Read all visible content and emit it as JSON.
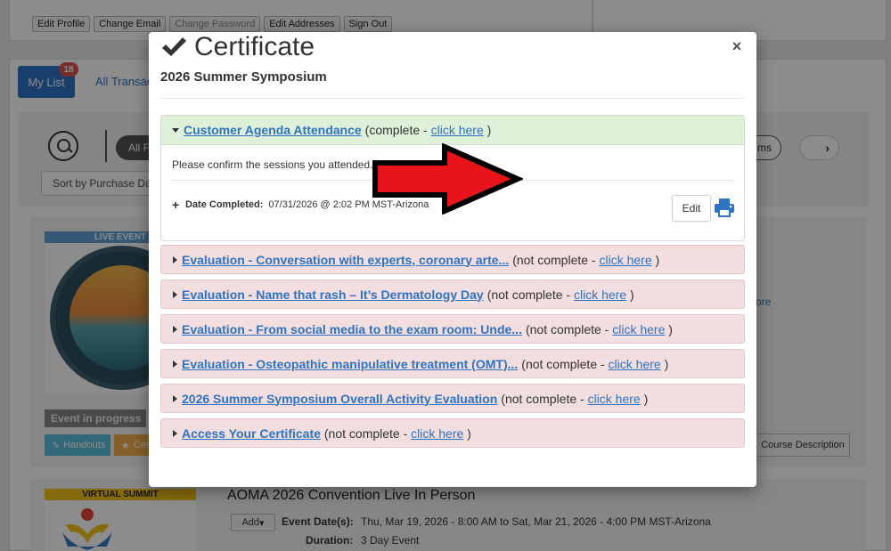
{
  "background": {
    "profile_buttons": [
      "Edit Profile",
      "Change Email",
      "Change Password",
      "Edit Addresses",
      "Sign Out"
    ],
    "tabs": {
      "my_list": "My List",
      "my_list_badge": "18",
      "all_transactions": "All Transac"
    },
    "filter": {
      "all_pill": "All F",
      "right_pill": "ms",
      "sort": "Sort by Purchase Da"
    },
    "event1": {
      "label": "LIVE EVENT",
      "progress": "Event in progress",
      "handouts": "Handouts",
      "cert": "Cer",
      "more": "ore",
      "course_description": "Course Description"
    },
    "event2": {
      "label": "VIRTUAL SUMMIT",
      "title": "AOMA 2026 Convention Live In Person",
      "add": "Add",
      "dates_label": "Event Date(s):",
      "dates_value": "Thu, Mar 19, 2026 - 8:00 AM to Sat, Mar 21, 2026 - 4:00 PM MST-Arizona",
      "duration_label": "Duration:",
      "duration_value": "3 Day Event"
    }
  },
  "modal": {
    "title": "Certificate",
    "close": "×",
    "subtitle": "2026 Summer Symposium",
    "open_section": {
      "title": "Customer Agenda Attendance ",
      "status_prefix": "(complete - ",
      "link": "click here",
      "status_suffix": " )",
      "body_text": "Please confirm the sessions you attended.",
      "date_label": "Date Completed:",
      "date_value": "07/31/2026 @ 2:02 PM MST-Arizona",
      "edit": "Edit"
    },
    "sections": [
      {
        "title": "Evaluation - Conversation with experts, coronary arte... ",
        "status": "(not complete - ",
        "link": "click here",
        "suffix": " )"
      },
      {
        "title": "Evaluation - Name that rash – It’s Dermatology Day ",
        "status": "(not complete - ",
        "link": "click here",
        "suffix": " )"
      },
      {
        "title": "Evaluation - From social media to the exam room: Unde... ",
        "status": "(not complete - ",
        "link": "click here",
        "suffix": " )"
      },
      {
        "title": "Evaluation - Osteopathic manipulative treatment (OMT)... ",
        "status": "(not complete - ",
        "link": "click here",
        "suffix": " )"
      },
      {
        "title": "2026 Summer Symposium Overall Activity Evaluation ",
        "status": "(not complete - ",
        "link": "click here",
        "suffix": " )"
      },
      {
        "title": "Access Your Certificate ",
        "status": "(not complete - ",
        "link": "click here",
        "suffix": " )"
      }
    ]
  },
  "colors": {
    "accent": "#2e73c5",
    "complete_bg": "#dff0d8",
    "incomplete_bg": "#f2dede",
    "arrow": "#e8141b"
  }
}
